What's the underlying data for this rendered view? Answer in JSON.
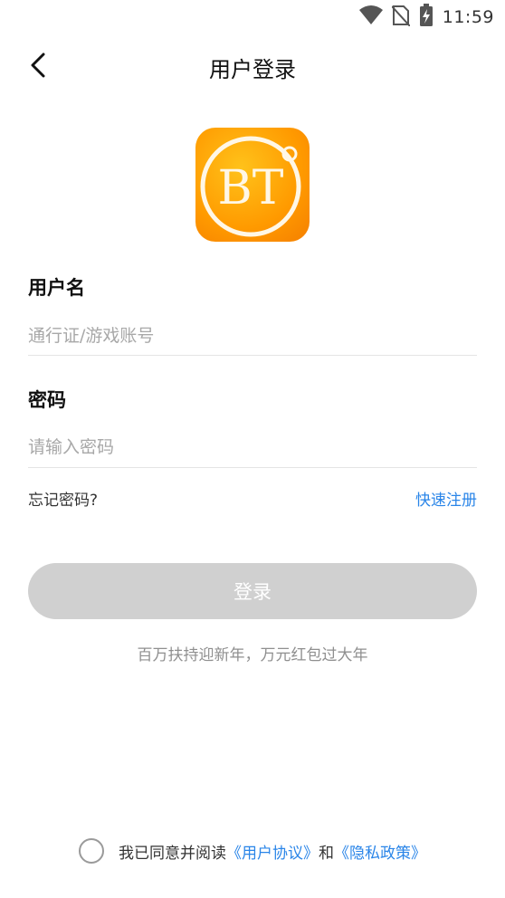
{
  "status_bar": {
    "time": "11:59"
  },
  "nav": {
    "title": "用户登录"
  },
  "logo": {
    "text": "BT"
  },
  "form": {
    "username_label": "用户名",
    "username_placeholder": "通行证/游戏账号",
    "password_label": "密码",
    "password_placeholder": "请输入密码",
    "forgot": "忘记密码?",
    "register": "快速注册"
  },
  "login_button": "登录",
  "promo": "百万扶持迎新年，万元红包过大年",
  "agreement": {
    "prefix": "我已同意并阅读",
    "user_agreement": "《用户协议》",
    "conj": "和",
    "privacy_policy": "《隐私政策》"
  },
  "colors": {
    "accent": "#2a85e8",
    "button_disabled": "#d0d0d0",
    "logo_orange": "#ff9a00"
  }
}
